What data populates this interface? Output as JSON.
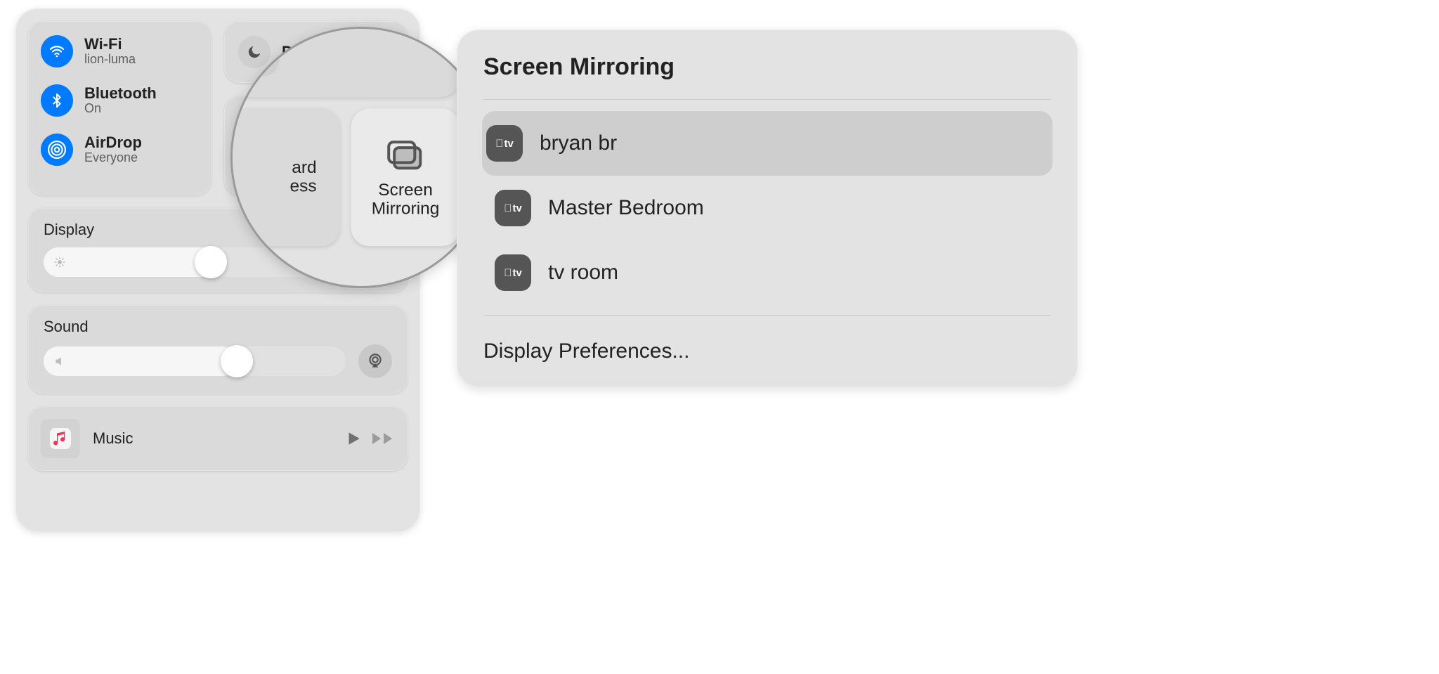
{
  "controlCenter": {
    "connectivity": {
      "wifi": {
        "title": "Wi-Fi",
        "subtitle": "lion-luma"
      },
      "bluetooth": {
        "title": "Bluetooth",
        "subtitle": "On"
      },
      "airdrop": {
        "title": "AirDrop",
        "subtitle": "Everyone"
      }
    },
    "dnd_label_fragment": "D",
    "keyboard_brightness_fragment_top": "ard",
    "keyboard_brightness_fragment_bottom": "ess",
    "screen_mirroring_label_top": "Screen",
    "screen_mirroring_label_bottom": "Mirroring",
    "display": {
      "title": "Display",
      "brightness_percent": 48
    },
    "sound": {
      "title": "Sound",
      "volume_percent": 64
    },
    "music": {
      "title": "Music"
    }
  },
  "magnifier": {
    "kb_fragment_top": "ard",
    "kb_fragment_bottom": "ess",
    "screen_mirroring_top": "Screen",
    "screen_mirroring_bottom": "Mirroring"
  },
  "screenMirroringPopover": {
    "title": "Screen Mirroring",
    "devices": [
      {
        "name": "bryan br",
        "icon_text": "tv",
        "selected": true
      },
      {
        "name": "Master Bedroom",
        "icon_text": "tv",
        "selected": false
      },
      {
        "name": "tv room",
        "icon_text": "tv",
        "selected": false
      }
    ],
    "footer_link": "Display Preferences..."
  }
}
